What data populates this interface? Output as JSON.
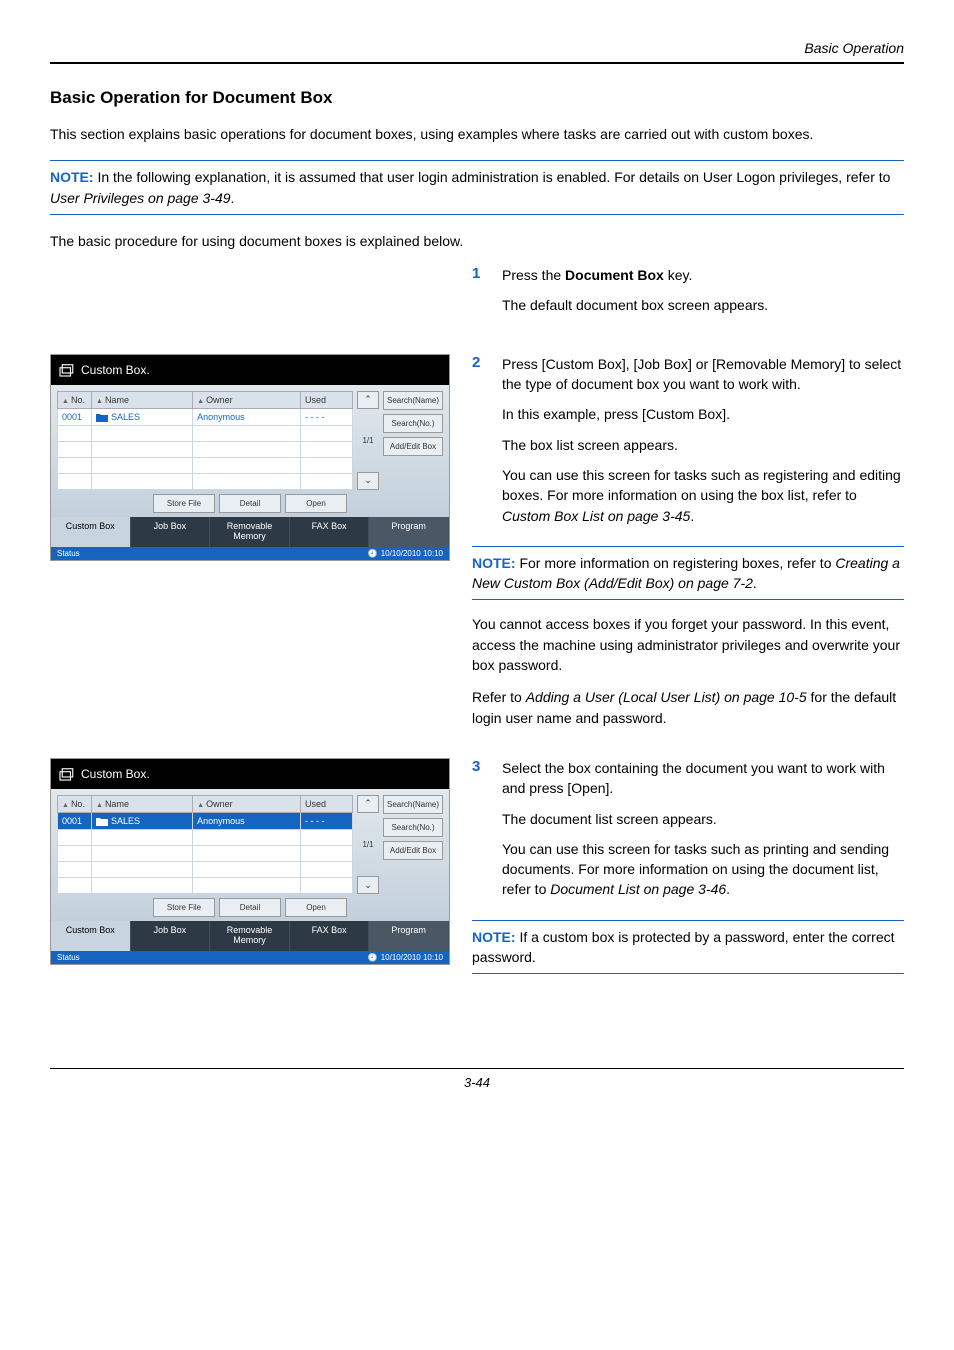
{
  "header": {
    "section": "Basic Operation"
  },
  "title": "Basic Operation for Document Box",
  "intro": "This section explains basic operations for document boxes, using examples where tasks are carried out with custom boxes.",
  "note1_prefix": "NOTE:",
  "note1_text": " In the following explanation, it is assumed that user login administration is enabled. For details on User Logon privileges, refer to ",
  "note1_ref": "User Privileges on page 3-49",
  "note1_end": ".",
  "line2": "The basic procedure for using document boxes is explained below.",
  "steps": {
    "s1": {
      "num": "1",
      "p1a": "Press the ",
      "p1b": "Document Box",
      "p1c": " key.",
      "p2": "The default document box screen appears."
    },
    "s2": {
      "num": "2",
      "p1": "Press [Custom Box], [Job Box] or [Removable Memory] to select the type of document box you want to work with.",
      "p2": "In this example, press [Custom Box].",
      "p3": "The box list screen appears.",
      "p4a": "You can use this screen for tasks such as registering and editing boxes. For more information on using the box list, refer to ",
      "p4b": "Custom Box List on page 3-45",
      "p4c": "."
    },
    "s3": {
      "num": "3",
      "p1": "Select the box containing the document you want to work with and press [Open].",
      "p2": "The document list screen appears.",
      "p3a": "You can use this screen for tasks such as printing and sending documents. For more information on using the document list, refer to ",
      "p3b": "Document List on page 3-46",
      "p3c": "."
    }
  },
  "note2_prefix": "NOTE:",
  "note2_a": " For more information on registering boxes, refer to ",
  "note2_ref": "Creating a New Custom Box (Add/Edit Box) on page 7-2",
  "note2_end": ".",
  "note2_p2": "You cannot access boxes if you forget your password. In this event, access the machine using administrator privileges and overwrite your box password.",
  "note2_p3a": "Refer to ",
  "note2_p3b": "Adding a User (Local User List) on page 10-5",
  "note2_p3c": " for the default login user name and password.",
  "note3_prefix": "NOTE:",
  "note3_text": " If a custom box is protected by a password, enter the correct password.",
  "panel": {
    "title": "Custom Box.",
    "headers": {
      "no": "No.",
      "name": "Name",
      "owner": "Owner",
      "used": "Used"
    },
    "tri": "▲",
    "row": {
      "no": "0001",
      "name": "SALES",
      "owner": "Anonymous",
      "used": "- - - -"
    },
    "side": {
      "searchName": "Search(Name)",
      "searchNo": "Search(No.)",
      "addEdit": "Add/Edit Box"
    },
    "page": "1/1",
    "lower": {
      "store": "Store File",
      "detail": "Detail",
      "open": "Open"
    },
    "tabs": {
      "custom": "Custom Box",
      "job": "Job Box",
      "removable": "Removable\nMemory",
      "fax": "FAX Box",
      "program": "Program"
    },
    "status": "Status",
    "timestamp": "10/10/2010   10:10",
    "up": "⌃",
    "down": "⌄"
  },
  "footer": {
    "page": "3-44"
  }
}
